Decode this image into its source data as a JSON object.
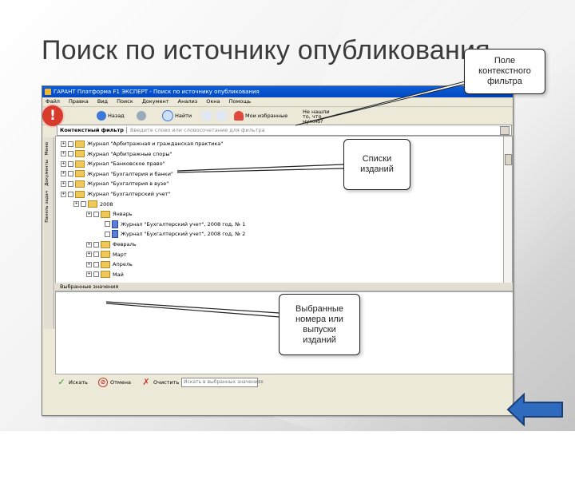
{
  "slide": {
    "title": "Поиск по источнику опубликования"
  },
  "app": {
    "window_title": "ГАРАНТ Платформа F1 ЭКСПЕРТ - Поиск по источнику опубликования",
    "menu": [
      "Файл",
      "Правка",
      "Вид",
      "Поиск",
      "Документ",
      "Анализ",
      "Окна",
      "Помощь"
    ],
    "toolbar": {
      "back": "Назад",
      "search": "Найти",
      "favorites": "Мои избранные",
      "hint": "Не нашли то, что нужно?"
    },
    "filter": {
      "label": "Контекстный фильтр",
      "placeholder": "Введите слово или словосочетание для фильтра"
    },
    "side_tabs": [
      "Меню",
      "Документы",
      "Панель задач"
    ],
    "tree": [
      {
        "text": "Журнал \"Арбитражная и гражданская практика\"",
        "level": 0,
        "type": "folder"
      },
      {
        "text": "Журнал \"Арбитражные споры\"",
        "level": 0,
        "type": "folder"
      },
      {
        "text": "Журнал \"Банковское право\"",
        "level": 0,
        "type": "folder"
      },
      {
        "text": "Журнал \"Бухгалтерия и банки\"",
        "level": 0,
        "type": "folder"
      },
      {
        "text": "Журнал \"Бухгалтерия в вузе\"",
        "level": 0,
        "type": "folder"
      },
      {
        "text": "Журнал \"Бухгалтерский учет\"",
        "level": 0,
        "type": "folder"
      },
      {
        "text": "2008",
        "level": 1,
        "type": "folder"
      },
      {
        "text": "Январь",
        "level": 2,
        "type": "folder"
      },
      {
        "text": "Журнал \"Бухгалтерский учет\", 2008 год, № 1",
        "level": 3,
        "type": "doc"
      },
      {
        "text": "Журнал \"Бухгалтерский учет\", 2008 год, № 2",
        "level": 3,
        "type": "doc"
      },
      {
        "text": "Февраль",
        "level": 2,
        "type": "folder"
      },
      {
        "text": "Март",
        "level": 2,
        "type": "folder"
      },
      {
        "text": "Апрель",
        "level": 2,
        "type": "folder"
      },
      {
        "text": "Май",
        "level": 2,
        "type": "folder"
      }
    ],
    "selected_header": "Выбранные значения",
    "bottom": {
      "find": "Искать",
      "cancel": "Отмена",
      "clear": "Очистить",
      "combo": "Искать в выбранных значениях"
    }
  },
  "callouts": {
    "filter_field": "Поле контекстного фильтра",
    "lists": "Списки изданий",
    "selected": "Выбранные номера или выпуски изданий"
  },
  "colors": {
    "titlebar": "#0a5fd8",
    "folder": "#f0c85a",
    "nav_button": "#2e6bbf"
  }
}
